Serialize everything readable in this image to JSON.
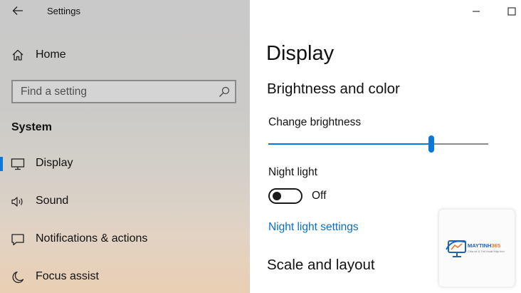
{
  "app": {
    "title": "Settings"
  },
  "sidebar": {
    "home_label": "Home",
    "search_placeholder": "Find a setting",
    "section_title": "System",
    "items": [
      {
        "label": "Display",
        "icon": "monitor-icon",
        "active": true
      },
      {
        "label": "Sound",
        "icon": "speaker-icon",
        "active": false
      },
      {
        "label": "Notifications & actions",
        "icon": "notification-icon",
        "active": false
      },
      {
        "label": "Focus assist",
        "icon": "moon-icon",
        "active": false
      }
    ]
  },
  "main": {
    "page_title": "Display",
    "brightness_section": "Brightness and color",
    "brightness_label": "Change brightness",
    "brightness_level": 0.74,
    "night_light_label": "Night light",
    "night_light_state": "Off",
    "night_light_link": "Night light settings",
    "scale_section": "Scale and layout"
  },
  "watermark": {
    "brand_main": "MAYTINH",
    "brand_accent": "365",
    "tagline": "Chia sẻ & Thủ thuật Máy tính"
  },
  "colors": {
    "accent": "#0a78d4",
    "link": "#0a6fc4",
    "brand_blue": "#1d63b8",
    "brand_orange": "#e8762d"
  }
}
